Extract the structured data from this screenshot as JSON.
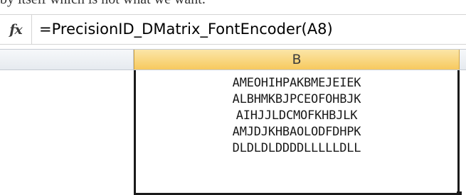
{
  "top_caption": "by itself which is not what we want.",
  "formula_bar": {
    "fx_icon": "function-fx-icon",
    "fx_label": "fx",
    "formula": "=PrecisionID_DMatrix_FontEncoder(A8)"
  },
  "columns": {
    "b_header": "B"
  },
  "cell_b": {
    "lines": [
      "AMEOHIHPAKBMEJEIEK",
      "ALBHMKBJPCEOFOHBJK",
      "AIHJJLDCMOFKHBJLK",
      "AMJDJKHBAOLODFDHPK",
      "DLDLDLDDDDLLLLLDLL"
    ]
  },
  "colors": {
    "selected_header_top": "#fbe6a8",
    "selected_header_bottom": "#f7c95e",
    "cell_border": "#1a1a1a",
    "gridline": "#d4d4d4"
  }
}
